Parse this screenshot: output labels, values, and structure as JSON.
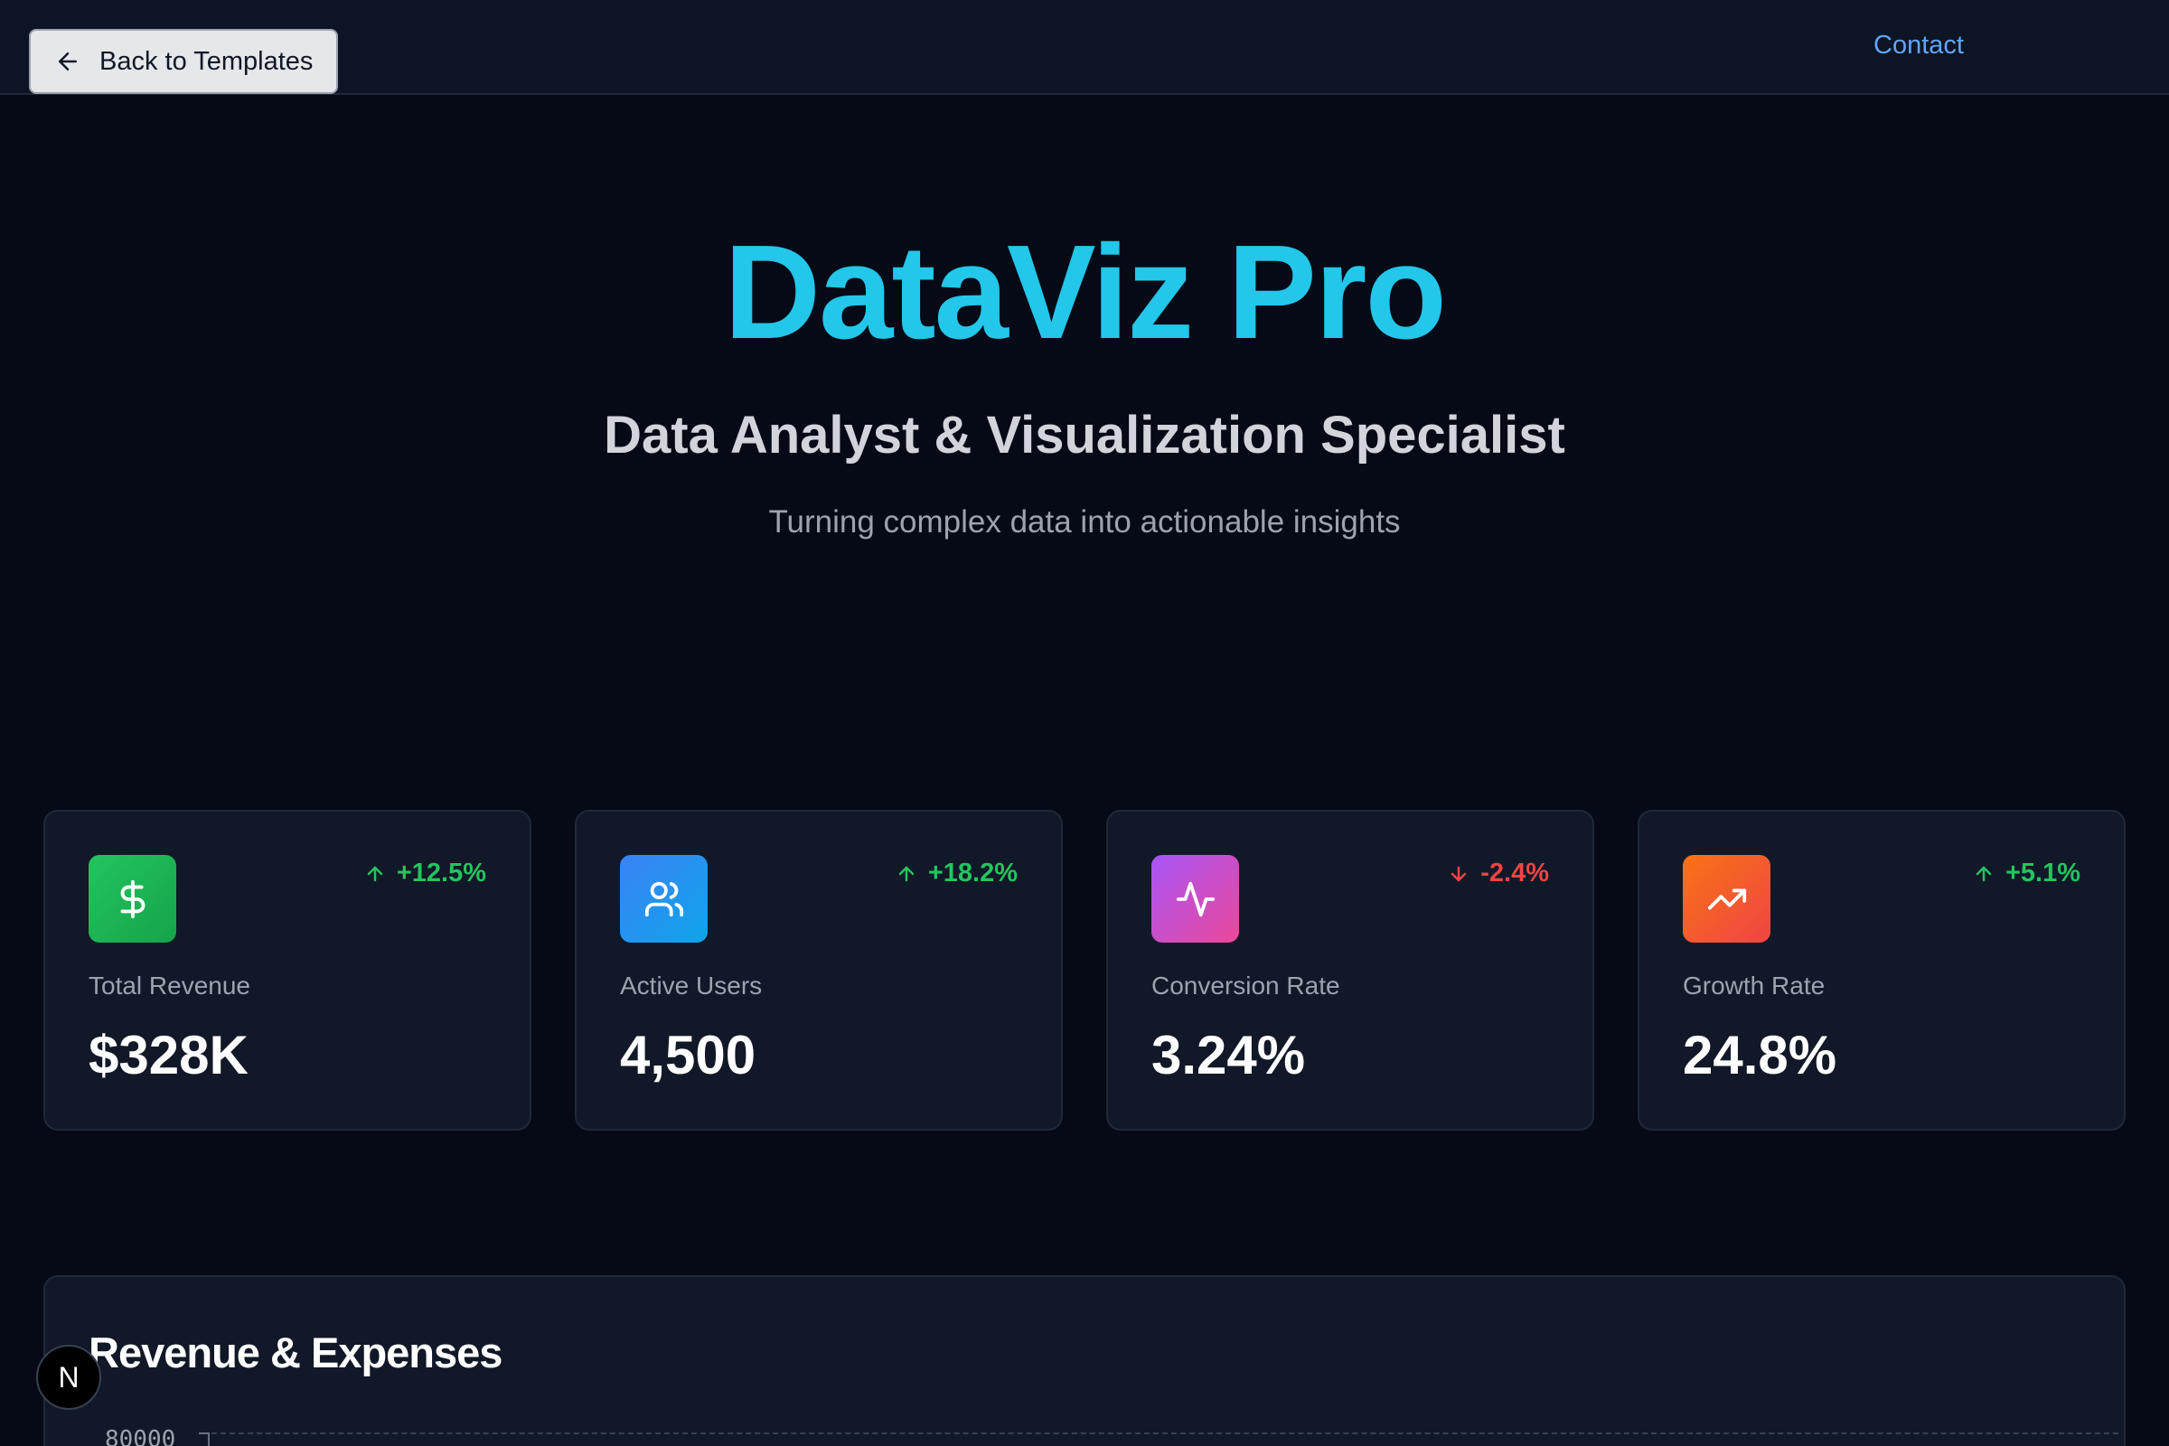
{
  "nav": {
    "back_label": "Back to Templates",
    "contact_label": "Contact"
  },
  "hero": {
    "title": "DataViz Pro",
    "subtitle": "Data Analyst & Visualization Specialist",
    "tagline": "Turning complex data into actionable insights"
  },
  "stats": [
    {
      "label": "Total Revenue",
      "value": "$328K",
      "change": "+12.5%",
      "direction": "up",
      "icon": "dollar-icon",
      "gradient": [
        "#22c55e",
        "#16a34a"
      ]
    },
    {
      "label": "Active Users",
      "value": "4,500",
      "change": "+18.2%",
      "direction": "up",
      "icon": "users-icon",
      "gradient": [
        "#3b82f6",
        "#0ea5e9"
      ]
    },
    {
      "label": "Conversion Rate",
      "value": "3.24%",
      "change": "-2.4%",
      "direction": "down",
      "icon": "activity-icon",
      "gradient": [
        "#a855f7",
        "#ec4899"
      ]
    },
    {
      "label": "Growth Rate",
      "value": "24.8%",
      "change": "+5.1%",
      "direction": "up",
      "icon": "trending-up-icon",
      "gradient": [
        "#f97316",
        "#ef4444"
      ]
    }
  ],
  "chart": {
    "title": "Revenue & Expenses",
    "top_tick": "80000"
  },
  "badge": {
    "letter": "N"
  },
  "colors": {
    "accent": "#22c7ea",
    "positive": "#22c55e",
    "negative": "#ef4444",
    "link": "#60a5fa"
  }
}
